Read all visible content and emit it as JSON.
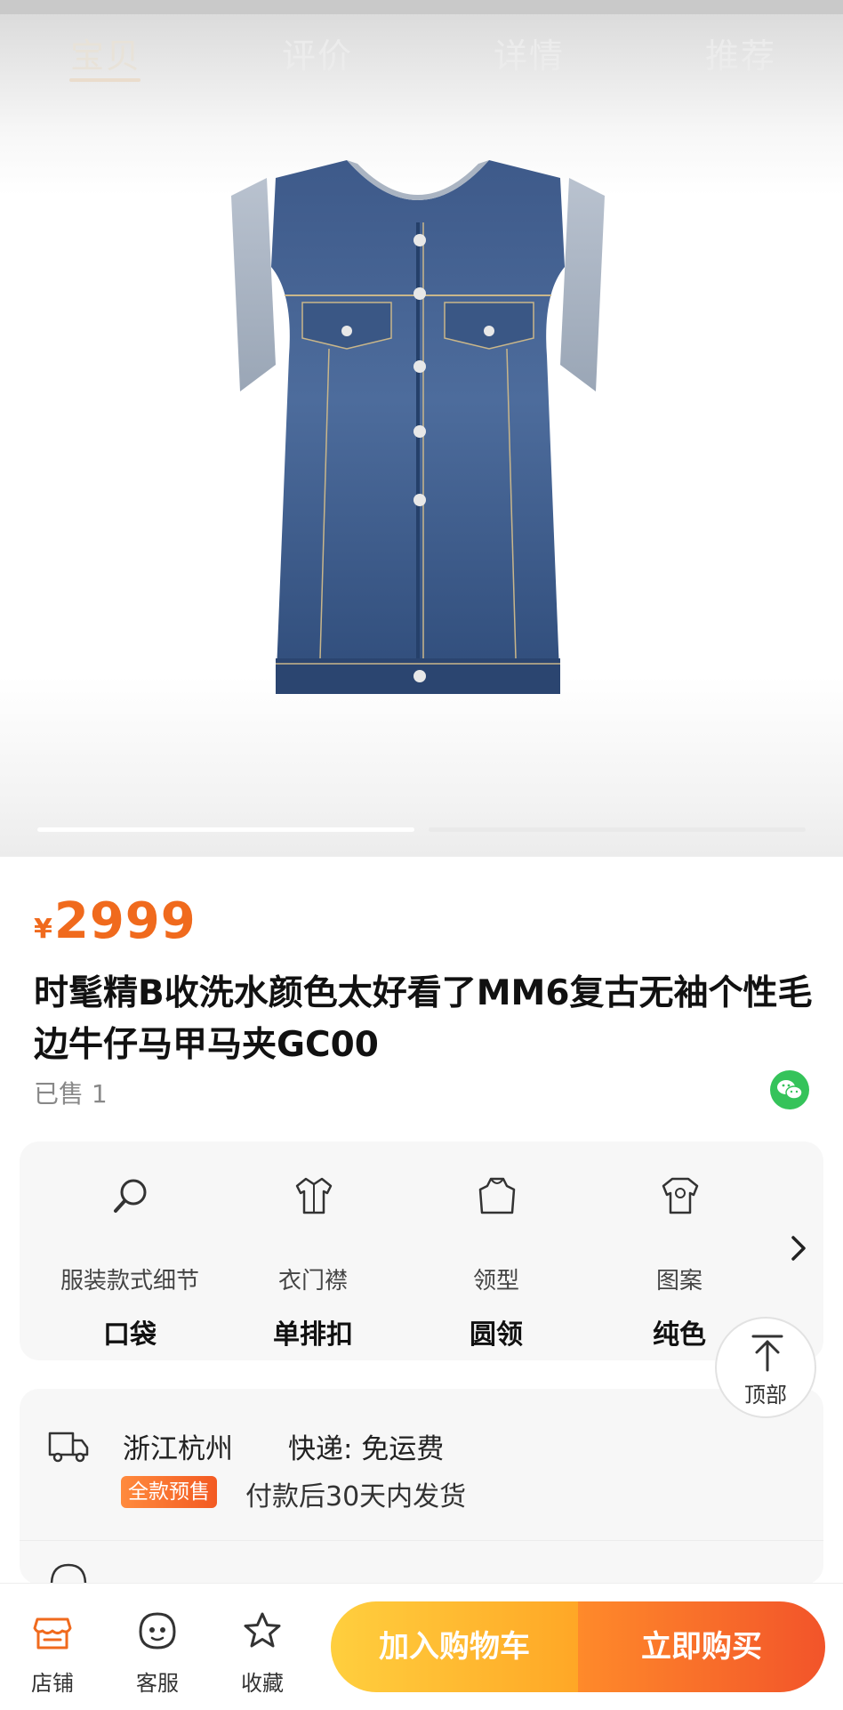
{
  "nav": {
    "tabs": [
      {
        "label": "宝贝"
      },
      {
        "label": "评价"
      },
      {
        "label": "详情"
      },
      {
        "label": "推荐"
      }
    ],
    "active_tab": 0
  },
  "gallery": {
    "image": "denim-vest-photo",
    "slides": 2,
    "active_slide": 1
  },
  "product": {
    "currency": "¥",
    "price": "2999",
    "title": "时髦精B收洗水颜色太好看了MM6复古无袖个性毛边牛仔马甲马夹GC00",
    "sold": "已售 1",
    "share_icon": "wechat-icon"
  },
  "attributes": [
    {
      "icon": "magnifier-icon",
      "label": "服装款式细节",
      "value": "口袋"
    },
    {
      "icon": "shirt-placket-icon",
      "label": "衣门襟",
      "value": "单排扣"
    },
    {
      "icon": "collar-icon",
      "label": "领型",
      "value": "圆领"
    },
    {
      "icon": "pattern-shirt-icon",
      "label": "图案",
      "value": "纯色"
    }
  ],
  "back_to_top": {
    "label": "顶部"
  },
  "shipping": {
    "location": "浙江杭州",
    "express": "快递:  免运费",
    "presale_badge": "全款预售",
    "note": "付款后30天内发货"
  },
  "bottom_bar": {
    "items": [
      {
        "icon": "shop-icon",
        "label": "店铺"
      },
      {
        "icon": "service-icon",
        "label": "客服"
      },
      {
        "icon": "star-icon",
        "label": "收藏"
      }
    ],
    "add_to_cart": "加入购物车",
    "buy_now": "立即购买"
  },
  "colors": {
    "accent": "#f06a1d",
    "cart_gradient": [
      "#ffcf3e",
      "#ffa726"
    ],
    "buy_gradient": [
      "#ff8a2a",
      "#f2542a"
    ],
    "presale_badge": "#f35a22",
    "wechat": "#35c35a"
  }
}
